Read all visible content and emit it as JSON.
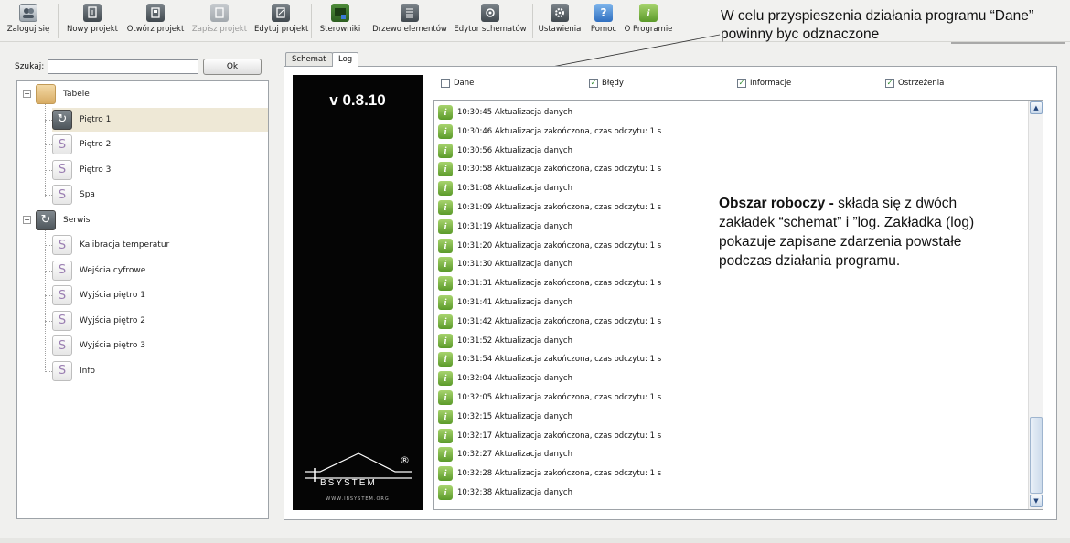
{
  "toolbar": {
    "buttons": [
      {
        "label": "Zaloguj się",
        "icon": "users-icon"
      },
      {
        "label": "Nowy projekt",
        "icon": "new-project-icon"
      },
      {
        "label": "Otwórz projekt",
        "icon": "open-project-icon"
      },
      {
        "label": "Zapisz projekt",
        "icon": "save-project-icon"
      },
      {
        "label": "Edytuj projekt",
        "icon": "edit-project-icon"
      },
      {
        "label": "Sterowniki",
        "icon": "controllers-icon"
      },
      {
        "label": "Drzewo elementów",
        "icon": "element-tree-icon"
      },
      {
        "label": "Edytor schematów",
        "icon": "schema-editor-icon"
      },
      {
        "label": "Ustawienia",
        "icon": "settings-icon"
      },
      {
        "label": "Pomoc",
        "icon": "help-icon"
      },
      {
        "label": "O Programie",
        "icon": "about-icon"
      }
    ]
  },
  "annotations": {
    "top": "W celu przyspieszenia działania programu “Dane” powinny byc odznaczone",
    "middle_bold": "Obszar roboczy - ",
    "middle_text": "składa się z dwóch zakładek “schemat” i ”log. Zakładka (log) pokazuje zapisane zdarzenia powstałe podczas działania programu."
  },
  "search": {
    "label": "Szukaj:",
    "value": "",
    "button": "Ok"
  },
  "tree": {
    "groups": [
      {
        "label": "Tabele",
        "icon": "folder-icon",
        "children": [
          "Piętro 1",
          "Piętro 2",
          "Piętro 3",
          "Spa"
        ]
      },
      {
        "label": "Serwis",
        "icon": "refresh-icon",
        "children": [
          "Kalibracja temperatur",
          "Wejścia cyfrowe",
          "Wyjścia piętro 1",
          "Wyjścia piętro 2",
          "Wyjścia piętro 3",
          "Info"
        ]
      }
    ],
    "selected": "Piętro 1"
  },
  "tabs": [
    {
      "label": "Schemat",
      "active": false
    },
    {
      "label": "Log",
      "active": true
    }
  ],
  "branding": {
    "version": "v 0.8.10",
    "logo_word": "BSYSTEM",
    "logo_url": "WWW.IBSYSTEM.ORG",
    "registered": "®"
  },
  "filters": [
    {
      "label": "Dane",
      "checked": false
    },
    {
      "label": "Błędy",
      "checked": true
    },
    {
      "label": "Informacje",
      "checked": true
    },
    {
      "label": "Ostrzeżenia",
      "checked": true
    }
  ],
  "log": [
    "10:30:45 Aktualizacja danych",
    "10:30:46 Aktualizacja zakończona, czas odczytu: 1 s",
    "10:30:56 Aktualizacja danych",
    "10:30:58 Aktualizacja zakończona, czas odczytu: 1 s",
    "10:31:08 Aktualizacja danych",
    "10:31:09 Aktualizacja zakończona, czas odczytu: 1 s",
    "10:31:19 Aktualizacja danych",
    "10:31:20 Aktualizacja zakończona, czas odczytu: 1 s",
    "10:31:30 Aktualizacja danych",
    "10:31:31 Aktualizacja zakończona, czas odczytu: 1 s",
    "10:31:41 Aktualizacja danych",
    "10:31:42 Aktualizacja zakończona, czas odczytu: 1 s",
    "10:31:52 Aktualizacja danych",
    "10:31:54 Aktualizacja zakończona, czas odczytu: 1 s",
    "10:32:04 Aktualizacja danych",
    "10:32:05 Aktualizacja zakończona, czas odczytu: 1 s",
    "10:32:15 Aktualizacja danych",
    "10:32:17 Aktualizacja zakończona, czas odczytu: 1 s",
    "10:32:27 Aktualizacja danych",
    "10:32:28 Aktualizacja zakończona, czas odczytu: 1 s",
    "10:32:38 Aktualizacja danych"
  ],
  "colors": {
    "accent_green": "#5b9a2a",
    "selection": "#eee8d6",
    "dark_panel": "#050505"
  }
}
